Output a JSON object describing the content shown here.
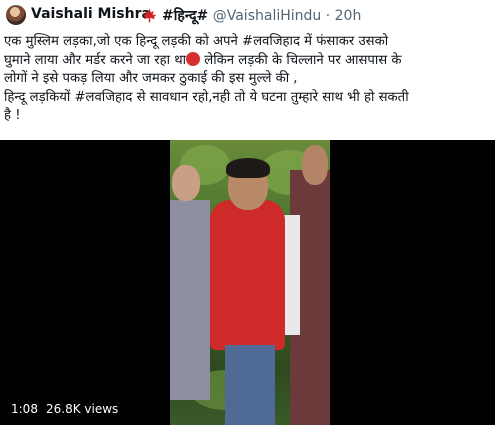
{
  "author": {
    "name": "Vaishali Mishra",
    "flag": "🍁",
    "name_suffix": "#हिन्दू#",
    "handle": "@VaishaliHindu",
    "separator": "·",
    "time": "20h"
  },
  "tweet": {
    "line1": "एक मुस्लिम लड़का,जो एक हिन्दू लड़की को अपने #लवजिहाद में फंसाकर उसको",
    "line2a": "घुमाने लाया और मर्डर करने जा रहा था",
    "line2b": " लेकिन लड़की के चिल्लाने पर आसपास के",
    "line3": "लोगों ने इसे पकड़ लिया और जमकर ठुकाई की इस मुल्ले की ,",
    "line4": "हिन्दू लड़कियों #लवजिहाद से सावधान रहो,नही तो ये घटना तुम्हारे साथ भी हो सकती",
    "line5": "है !"
  },
  "video": {
    "duration": "1:08",
    "views": "26.8K views"
  }
}
